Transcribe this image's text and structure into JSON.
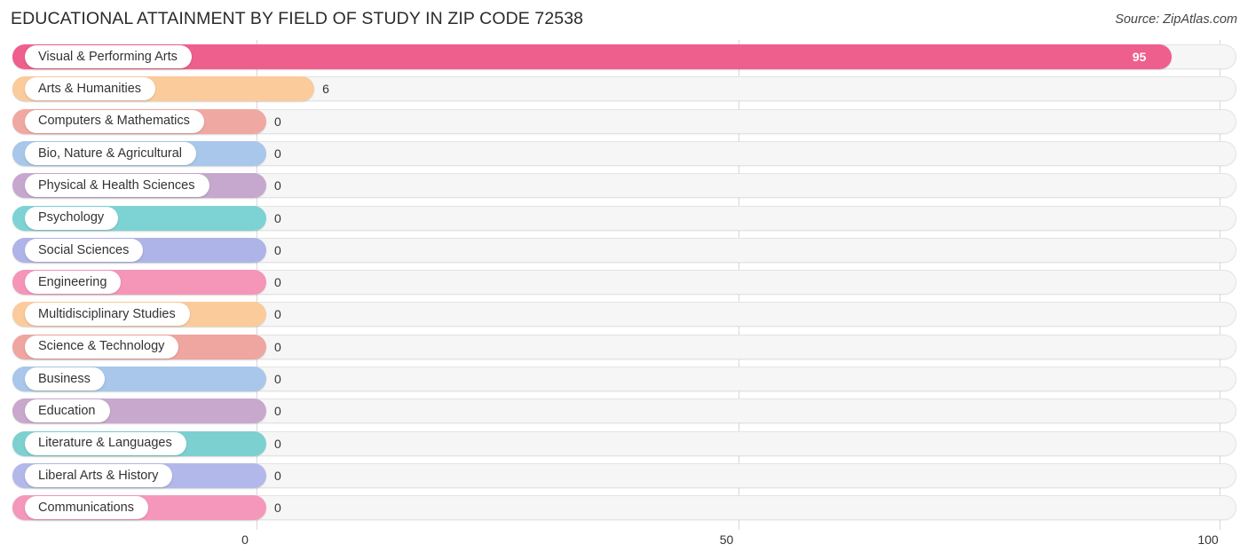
{
  "header": {
    "title": "EDUCATIONAL ATTAINMENT BY FIELD OF STUDY IN ZIP CODE 72538",
    "source": "Source: ZipAtlas.com"
  },
  "chart_data": {
    "type": "bar",
    "orientation": "horizontal",
    "title": "EDUCATIONAL ATTAINMENT BY FIELD OF STUDY IN ZIP CODE 72538",
    "xlabel": "",
    "ylabel": "",
    "xlim": [
      0,
      100
    ],
    "xticks": [
      0,
      50,
      100
    ],
    "xtick_labels": [
      "0",
      "50",
      "100"
    ],
    "grid": "vertical",
    "legend": "none",
    "categories": [
      "Visual & Performing Arts",
      "Arts & Humanities",
      "Computers & Mathematics",
      "Bio, Nature & Agricultural",
      "Physical & Health Sciences",
      "Psychology",
      "Social Sciences",
      "Engineering",
      "Multidisciplinary Studies",
      "Science & Technology",
      "Business",
      "Education",
      "Literature & Languages",
      "Liberal Arts & History",
      "Communications"
    ],
    "values": [
      95,
      6,
      0,
      0,
      0,
      0,
      0,
      0,
      0,
      0,
      0,
      0,
      0,
      0,
      0
    ],
    "value_labels": [
      "95",
      "6",
      "0",
      "0",
      "0",
      "0",
      "0",
      "0",
      "0",
      "0",
      "0",
      "0",
      "0",
      "0",
      "0"
    ],
    "colors": [
      "#ef5f8d",
      "#fbcb9c",
      "#f0a8a2",
      "#a8c7ea",
      "#c6a8cf",
      "#7dd3d3",
      "#aeb4e8",
      "#f595b8",
      "#fbcb9c",
      "#efa5a0",
      "#a8c7ea",
      "#c9a8cd",
      "#7dd0d0",
      "#b2b8ea",
      "#f597bb"
    ]
  }
}
